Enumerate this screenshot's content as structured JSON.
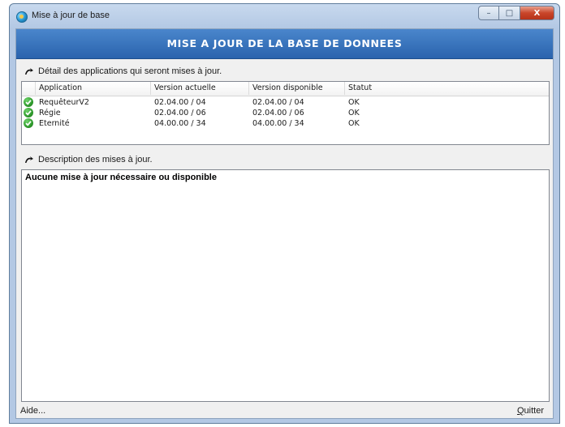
{
  "window": {
    "title": "Mise à jour de base",
    "buttons": {
      "minimize": "–",
      "maximize": "□",
      "close": "X"
    }
  },
  "header": {
    "title": "MISE A JOUR DE LA BASE DE DONNEES"
  },
  "details": {
    "label": "Détail des applications qui seront mises à jour.",
    "columns": [
      "Application",
      "Version actuelle",
      "Version disponible",
      "Statut"
    ],
    "rows": [
      {
        "application": "RequêteurV2",
        "version_actuelle": "02.04.00 / 04",
        "version_disponible": "02.04.00 / 04",
        "statut": "OK"
      },
      {
        "application": "Régie",
        "version_actuelle": "02.04.00 / 06",
        "version_disponible": "02.04.00 / 06",
        "statut": "OK"
      },
      {
        "application": "Eternité",
        "version_actuelle": "04.00.00 / 34",
        "version_disponible": "04.00.00 / 34",
        "statut": "OK"
      }
    ]
  },
  "description": {
    "label": "Description des mises à jour.",
    "text": "Aucune mise à jour nécessaire ou disponible"
  },
  "footer": {
    "help_label": "Aide...",
    "quit_label": "Quitter"
  },
  "colors": {
    "header_band": "#3570bb",
    "status_ok": "#2f9a2c"
  }
}
